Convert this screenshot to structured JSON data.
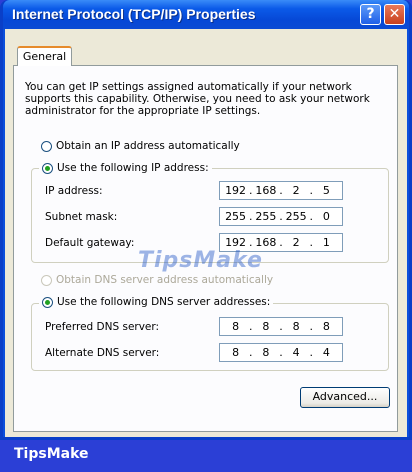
{
  "window": {
    "title": "Internet Protocol (TCP/IP) Properties",
    "help_symbol": "?",
    "close_symbol": "✕"
  },
  "tabs": [
    {
      "label": "General"
    }
  ],
  "intro_text": "You can get IP settings assigned automatically if your network supports this capability. Otherwise, you need to ask your network administrator for the appropriate IP settings.",
  "ip_section": {
    "auto_label": "Obtain an IP address automatically",
    "manual_label": "Use the following IP address:",
    "selected": "manual",
    "fields": [
      {
        "label": "IP address:",
        "octets": [
          "192",
          "168",
          "2",
          "5"
        ]
      },
      {
        "label": "Subnet mask:",
        "octets": [
          "255",
          "255",
          "255",
          "0"
        ]
      },
      {
        "label": "Default gateway:",
        "octets": [
          "192",
          "168",
          "2",
          "1"
        ]
      }
    ]
  },
  "dns_section": {
    "auto_label": "Obtain DNS server address automatically",
    "manual_label": "Use the following DNS server addresses:",
    "selected": "manual",
    "fields": [
      {
        "label": "Preferred DNS server:",
        "octets": [
          "8",
          "8",
          "8",
          "8"
        ]
      },
      {
        "label": "Alternate DNS server:",
        "octets": [
          "8",
          "8",
          "4",
          "4"
        ]
      }
    ]
  },
  "advanced_label": "Advanced...",
  "watermark_text": "TipsMake",
  "footer_brand": "TipsMake",
  "colors": {
    "title_bar": "#0b5ae8",
    "dialog_bg": "#ece9d8",
    "tab_accent": "#e68b2c",
    "radio_dot": "#21a121",
    "frame": "#2b3fd6"
  }
}
